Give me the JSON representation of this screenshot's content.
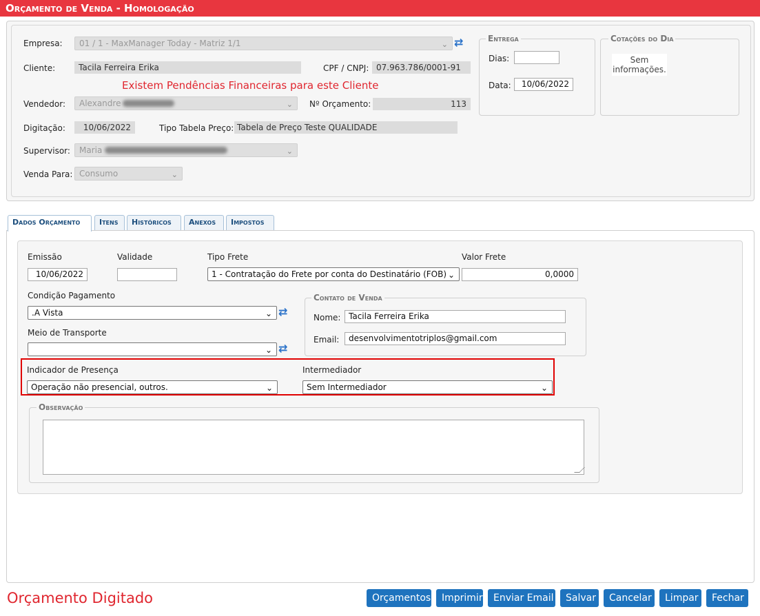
{
  "window": {
    "title": "Orçamento de Venda  - Homologação"
  },
  "header_form": {
    "empresa_label": "Empresa:",
    "empresa_value": "01 / 1 - MaxManager Today - Matriz 1/1",
    "cliente_label": "Cliente:",
    "cliente_value": "Tacila Ferreira Erika",
    "cpf_label": "CPF / CNPJ:",
    "cpf_value": "07.963.786/0001-91",
    "pendencias_msg": "Existem Pendências Financeiras para este Cliente",
    "vendedor_label": "Vendedor:",
    "vendedor_value": "Alexandre",
    "orcamento_label": "Nº Orçamento:",
    "orcamento_value": "113",
    "digitacao_label": "Digitação:",
    "digitacao_value": "10/06/2022",
    "tipo_tabela_label": "Tipo Tabela Preço:",
    "tipo_tabela_value": "Tabela de Preço Teste QUALIDADE",
    "supervisor_label": "Supervisor:",
    "supervisor_value": "Maria",
    "venda_para_label": "Venda Para:",
    "venda_para_value": "Consumo"
  },
  "entrega": {
    "legend": "Entrega",
    "dias_label": "Dias:",
    "dias_value": "",
    "data_label": "Data:",
    "data_value": "10/06/2022"
  },
  "cotacoes": {
    "legend": "Cotações do Dia",
    "message": "Sem informações."
  },
  "tabs": [
    {
      "label": "Dados Orçamento"
    },
    {
      "label": "Itens"
    },
    {
      "label": "Históricos"
    },
    {
      "label": "Anexos"
    },
    {
      "label": "Impostos"
    }
  ],
  "dados": {
    "emissao_label": "Emissão",
    "emissao_value": "10/06/2022",
    "validade_label": "Validade",
    "validade_value": "",
    "tipo_frete_label": "Tipo Frete",
    "tipo_frete_value": "1 - Contratação do Frete por conta do Destinatário (FOB)",
    "valor_frete_label": "Valor Frete",
    "valor_frete_value": "0,0000",
    "condicao_label": "Condição Pagamento",
    "condicao_value": ".A Vista",
    "meio_transporte_label": "Meio de Transporte",
    "meio_transporte_value": "",
    "indicador_label": "Indicador de Presença",
    "indicador_value": "Operação não presencial, outros.",
    "intermediador_label": "Intermediador",
    "intermediador_value": "Sem Intermediador"
  },
  "contato": {
    "legend": "Contato de Venda",
    "nome_label": "Nome:",
    "nome_value": "Tacila Ferreira Erika",
    "email_label": "Email:",
    "email_value": "desenvolvimentotriplos@gmail.com"
  },
  "observacao": {
    "legend": "Observação",
    "value": ""
  },
  "footer": {
    "status": "Orçamento Digitado",
    "buttons": [
      "Orçamentos",
      "Imprimir",
      "Enviar Email",
      "Salvar",
      "Cancelar",
      "Limpar",
      "Fechar"
    ]
  },
  "colors": {
    "title_bar": "#e8363f",
    "button": "#1e73be",
    "alert_text": "#e0262f",
    "highlight_border": "#e00000"
  },
  "icons": {
    "refresh": "refresh-icon",
    "dropdown": "chevron-down-icon"
  }
}
